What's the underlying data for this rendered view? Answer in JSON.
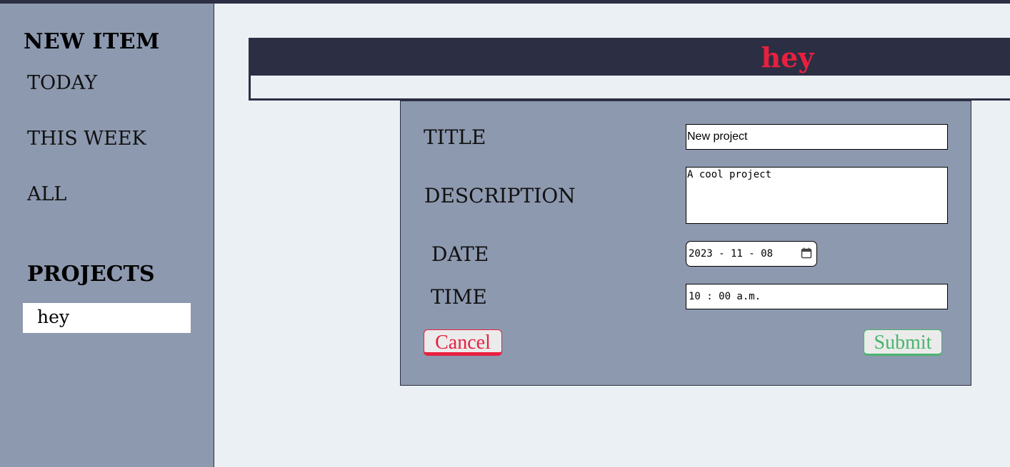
{
  "sidebar": {
    "new_item": "NEW ITEM",
    "nav": [
      "TODAY",
      "THIS WEEK",
      "ALL"
    ],
    "projects_heading": "PROJECTS",
    "projects": [
      "hey"
    ]
  },
  "project": {
    "title": "hey"
  },
  "form": {
    "title_label": "TITLE",
    "description_label": "DESCRIPTION",
    "date_label": "DATE",
    "time_label": "TIME",
    "title_value": "New project",
    "description_value": "A cool project",
    "date_value": "2023 - 11 - 08",
    "time_value": "10 : 00  a.m.",
    "cancel_label": "Cancel",
    "submit_label": "Submit"
  },
  "icons": {
    "calendar": "calendar-icon"
  },
  "colors": {
    "dark": "#2c2e43",
    "sidebar": "#8d99af",
    "background": "#ebf0f4",
    "accent_red": "#e8203f",
    "accent_green": "#4ab56e"
  }
}
